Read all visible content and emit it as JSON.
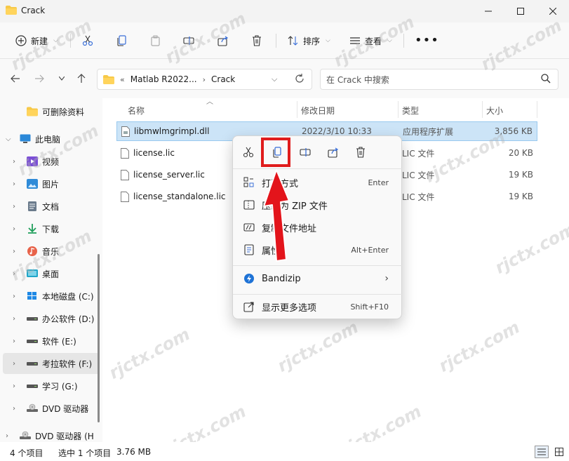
{
  "window": {
    "title": "Crack"
  },
  "toolbar": {
    "new_label": "新建",
    "sort_label": "排序",
    "view_label": "查看"
  },
  "address": {
    "prefix": "«",
    "crumbs": [
      "Matlab R2022...",
      "Crack"
    ]
  },
  "search": {
    "placeholder": "在 Crack 中搜索"
  },
  "sidebar": {
    "items": [
      {
        "label": "可删除资料",
        "icon": "folder-icon"
      },
      {
        "label": "此电脑",
        "icon": "computer-icon"
      },
      {
        "label": "视频",
        "icon": "video-icon"
      },
      {
        "label": "图片",
        "icon": "picture-icon"
      },
      {
        "label": "文档",
        "icon": "document-icon"
      },
      {
        "label": "下载",
        "icon": "download-icon"
      },
      {
        "label": "音乐",
        "icon": "music-icon"
      },
      {
        "label": "桌面",
        "icon": "desktop-icon"
      },
      {
        "label": "本地磁盘 (C:)",
        "icon": "drive-icon"
      },
      {
        "label": "办公软件 (D:)",
        "icon": "drive-icon"
      },
      {
        "label": "软件 (E:)",
        "icon": "drive-icon"
      },
      {
        "label": "考拉软件 (F:)",
        "icon": "drive-icon"
      },
      {
        "label": "学习 (G:)",
        "icon": "drive-icon"
      },
      {
        "label": "DVD 驱动器",
        "icon": "dvd-icon"
      },
      {
        "label": "DVD 驱动器 (H",
        "icon": "dvd-icon"
      }
    ]
  },
  "columns": {
    "name": "名称",
    "date": "修改日期",
    "type": "类型",
    "size": "大小"
  },
  "files": [
    {
      "name": "libmwlmgrimpl.dll",
      "date": "2022/3/10 10:33",
      "type": "应用程序扩展",
      "size": "3,856 KB"
    },
    {
      "name": "license.lic",
      "date": "",
      "type": "LIC 文件",
      "size": "20 KB"
    },
    {
      "name": "license_server.lic",
      "date": "",
      "type": "LIC 文件",
      "size": "19 KB"
    },
    {
      "name": "license_standalone.lic",
      "date": "",
      "type": "LIC 文件",
      "size": "19 KB"
    }
  ],
  "context_menu": {
    "items": [
      {
        "label": "打开方式",
        "shortcut": "Enter"
      },
      {
        "label": "压缩为 ZIP 文件",
        "shortcut": ""
      },
      {
        "label": "复制文件地址",
        "shortcut": ""
      },
      {
        "label": "属性",
        "shortcut": "Alt+Enter"
      },
      {
        "label": "Bandizip",
        "shortcut": ""
      },
      {
        "label": "显示更多选项",
        "shortcut": "Shift+F10"
      }
    ]
  },
  "status": {
    "count": "4 个项目",
    "selected": "选中 1 个项目",
    "size": "3.76 MB"
  },
  "watermark": "rjctx.com",
  "colors": {
    "accent": "#0067c0",
    "highlight_box": "#e01c1c",
    "selection": "#cce4f7"
  }
}
